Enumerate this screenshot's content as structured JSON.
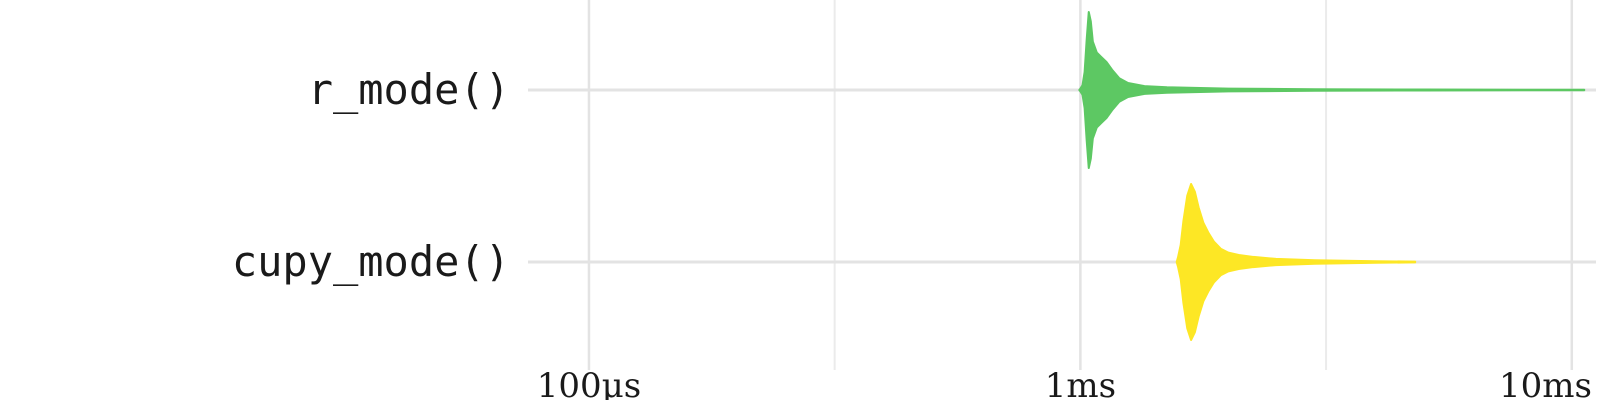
{
  "chart_data": {
    "type": "violin",
    "title": "",
    "xlabel": "",
    "ylabel": "",
    "x_scale": "log10",
    "x_unit": "seconds",
    "xlim": [
      7.95e-05,
      0.0112
    ],
    "major_ticks": [
      {
        "value": 0.0001,
        "label": "100µs"
      },
      {
        "value": 0.001,
        "label": "1ms"
      },
      {
        "value": 0.01,
        "label": "10ms"
      }
    ],
    "minor_ticks": [
      0.0003162,
      0.003162
    ],
    "grid": true,
    "legend": "none",
    "series": [
      {
        "label": "r_mode()",
        "color": "#5dc863",
        "min": 0.000995,
        "max": 0.0106,
        "density": [
          [
            0.000995,
            0.0
          ],
          [
            0.001,
            0.018
          ],
          [
            0.00101,
            0.06
          ],
          [
            0.00102,
            0.23
          ],
          [
            0.00103,
            0.65
          ],
          [
            0.00104,
            1.0
          ],
          [
            0.00105,
            0.88
          ],
          [
            0.00106,
            0.62
          ],
          [
            0.00108,
            0.48
          ],
          [
            0.0011,
            0.43
          ],
          [
            0.00113,
            0.36
          ],
          [
            0.00116,
            0.26
          ],
          [
            0.0012,
            0.15
          ],
          [
            0.00125,
            0.09
          ],
          [
            0.00135,
            0.05
          ],
          [
            0.0015,
            0.035
          ],
          [
            0.002,
            0.018
          ],
          [
            0.003,
            0.01
          ],
          [
            0.005,
            0.006
          ],
          [
            0.008,
            0.004
          ],
          [
            0.0106,
            0.003
          ]
        ]
      },
      {
        "label": "cupy_mode()",
        "color": "#fde725",
        "min": 0.00157,
        "max": 0.0048,
        "density": [
          [
            0.00157,
            0.0
          ],
          [
            0.00158,
            0.06
          ],
          [
            0.0016,
            0.22
          ],
          [
            0.00162,
            0.52
          ],
          [
            0.00165,
            0.85
          ],
          [
            0.00168,
            1.0
          ],
          [
            0.00171,
            0.9
          ],
          [
            0.00174,
            0.7
          ],
          [
            0.00178,
            0.5
          ],
          [
            0.00182,
            0.38
          ],
          [
            0.00187,
            0.26
          ],
          [
            0.00193,
            0.17
          ],
          [
            0.002,
            0.12
          ],
          [
            0.0021,
            0.09
          ],
          [
            0.00225,
            0.065
          ],
          [
            0.0025,
            0.04
          ],
          [
            0.003,
            0.022
          ],
          [
            0.004,
            0.01
          ],
          [
            0.0048,
            0.005
          ]
        ]
      }
    ]
  }
}
